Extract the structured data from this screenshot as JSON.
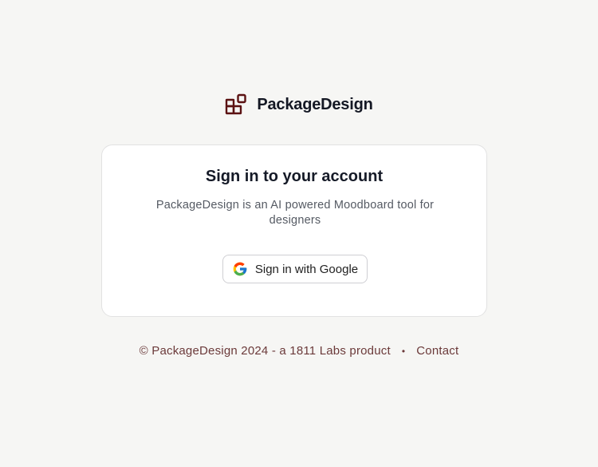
{
  "brand": {
    "icon": "package-boxes-icon",
    "name": "PackageDesign",
    "color": "#5b1212"
  },
  "card": {
    "title": "Sign in to your account",
    "description": "PackageDesign is an AI powered Moodboard tool for designers",
    "google_button": {
      "icon": "google-icon",
      "label": "Sign in with Google"
    }
  },
  "footer": {
    "copyright": "© PackageDesign 2024 - a 1811 Labs product",
    "separator": "•",
    "contact_label": "Contact",
    "color": "#6b3a3a"
  }
}
